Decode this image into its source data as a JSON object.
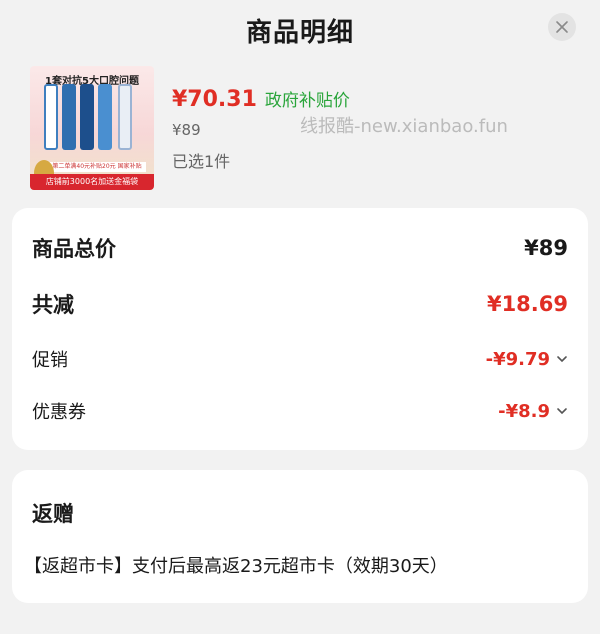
{
  "header": {
    "title": "商品明细"
  },
  "product": {
    "thumb_headline": "1套对抗5大口腔问题",
    "thumb_banner_small": "第二单满40元补贴20元 国家补贴",
    "thumb_banner_red": "店铺前3000名加送金福袋",
    "price": "¥70.31",
    "subsidy_label": "政府补贴价",
    "original_price": "¥89",
    "selected_text": "已选1件"
  },
  "watermark": "线报酷-new.xianbao.fun",
  "summary": {
    "total": {
      "label": "商品总价",
      "value": "¥89"
    },
    "reduction": {
      "label": "共减",
      "value": "¥18.69"
    },
    "promotion": {
      "label": "促销",
      "value": "-¥9.79"
    },
    "coupon": {
      "label": "优惠券",
      "value": "-¥8.9"
    }
  },
  "gift": {
    "title": "返赠",
    "description": "【返超市卡】支付后最高返23元超市卡（效期30天）"
  },
  "colors": {
    "accent_red": "#e02e24",
    "subsidy_green": "#2aa53b",
    "background": "#f2f2f2"
  }
}
